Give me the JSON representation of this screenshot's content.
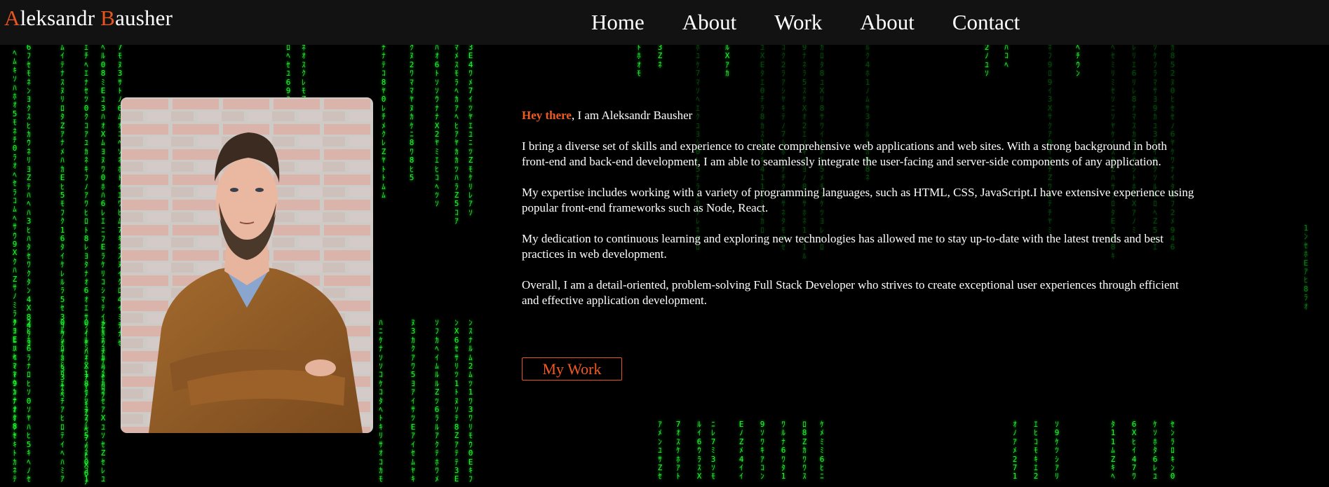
{
  "header": {
    "logo_first_initial": "A",
    "logo_first_rest": "leksandr ",
    "logo_last_initial": "B",
    "logo_last_rest": "ausher",
    "nav": [
      "Home",
      "About",
      "Work",
      "About",
      "Contact"
    ]
  },
  "intro": {
    "greeting": "Hey there",
    "greeting_rest": ", I am Aleksandr Bausher",
    "paragraphs": [
      "I bring a diverse set of skills and experience to create comprehensive web applications and web sites. With a strong background in both front-end and back-end development, I am able to seamlessly integrate the user-facing and server-side components of any application.",
      "My expertise includes working with a variety of programming languages, such as HTML, CSS, JavaScript.I have extensive experience using popular front-end frameworks such as Node, React.",
      "My dedication to continuous learning and exploring new technologies has allowed me to stay up-to-date with the latest trends and best practices in web development.",
      "Overall, I am a detail-oriented, problem-solving Full Stack Developer who strives to create exceptional user experiences through efficient and effective application development."
    ],
    "button_label": "My Work"
  },
  "theme": {
    "accent": "#e8561f",
    "background": "#000000",
    "header_background": "#121212",
    "rain_green": "#1dff2f"
  }
}
